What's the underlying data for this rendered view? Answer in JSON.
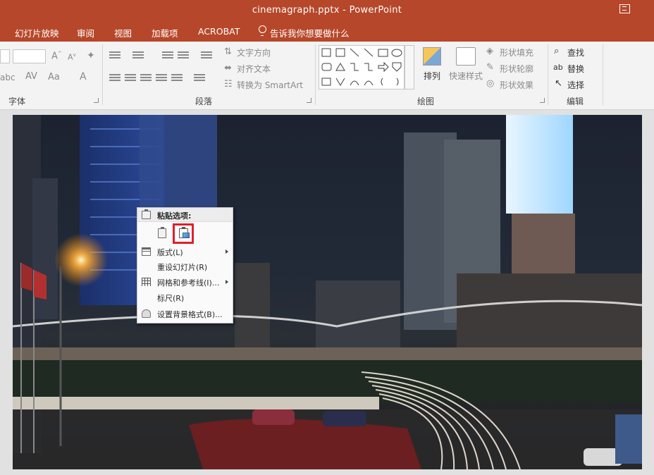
{
  "window": {
    "title": "cinemagraph.pptx - PowerPoint"
  },
  "tabs": [
    "幻灯片放映",
    "审阅",
    "视图",
    "加载项",
    "ACROBAT"
  ],
  "tell_me": "告诉我你想要做什么",
  "ribbon": {
    "font_group": {
      "label": "字体"
    },
    "paragraph_group": {
      "label": "段落",
      "text_direction": "文字方向",
      "align_text": "对齐文本",
      "convert_smartart": "转换为 SmartArt"
    },
    "drawing_group": {
      "label": "绘图",
      "arrange": "排列",
      "quick_styles": "快速样式",
      "shape_fill": "形状填充",
      "shape_outline": "形状轮廓",
      "shape_effects": "形状效果"
    },
    "editing_group": {
      "label": "编辑",
      "find": "查找",
      "replace": "替换",
      "select": "选择"
    }
  },
  "context_menu": {
    "header": "粘贴选项:",
    "items": [
      {
        "label": "版式(L)",
        "submenu": true
      },
      {
        "label": "重设幻灯片(R)",
        "submenu": false
      },
      {
        "label": "网格和参考线(I)...",
        "submenu": true
      },
      {
        "label": "标尺(R)",
        "submenu": false
      },
      {
        "label": "设置背景格式(B)...",
        "submenu": false
      }
    ]
  },
  "colors": {
    "accent": "#b7472a",
    "highlight": "#e0202a"
  }
}
